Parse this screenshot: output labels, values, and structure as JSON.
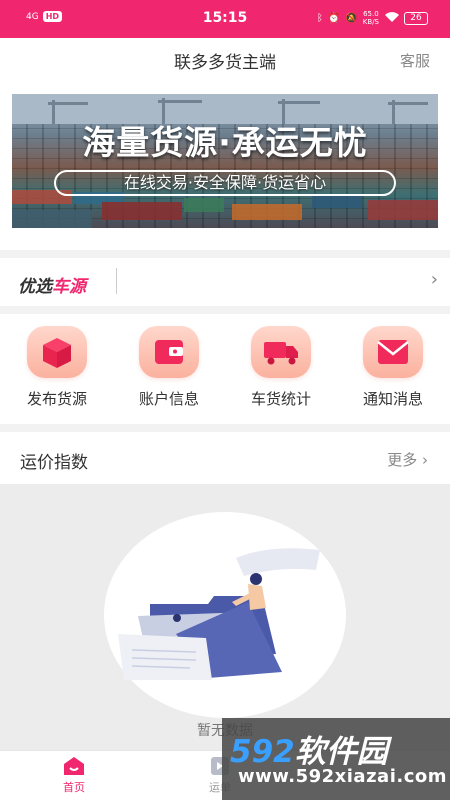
{
  "status_bar": {
    "network": "4G",
    "hd": "HD",
    "time": "15:15",
    "speed_value": "65.0",
    "speed_unit": "KB/S",
    "battery": "26",
    "background_color": "#f0276f"
  },
  "header": {
    "title": "联多多货主端",
    "service": "客服"
  },
  "banner": {
    "headline": "海量货源·承运无忧",
    "subline": "在线交易·安全保障·货运省心"
  },
  "pick_section": {
    "title_part1": "优选",
    "title_part2": "车源",
    "chevron": "›"
  },
  "quick_actions": [
    {
      "label": "发布货源",
      "icon": "box-icon"
    },
    {
      "label": "账户信息",
      "icon": "wallet-icon"
    },
    {
      "label": "车货统计",
      "icon": "truck-icon"
    },
    {
      "label": "通知消息",
      "icon": "envelope-icon"
    }
  ],
  "freight_index": {
    "title": "运价指数",
    "more": "更多 ›"
  },
  "empty_state": {
    "text": "暂无数据"
  },
  "watermark": {
    "brand_digits": "592",
    "brand_text": "软件园",
    "url": "www.592xiazai.com"
  },
  "tabbar": [
    {
      "label": "首页",
      "icon": "home-icon",
      "active": true
    },
    {
      "label": "运单",
      "icon": "waybill-icon",
      "active": false
    }
  ],
  "colors": {
    "accent": "#f0276f",
    "icon_gradient_top": "#ffd7cc",
    "icon_gradient_bottom": "#fbb19e",
    "illustration_blue": "#4a5aa8"
  }
}
